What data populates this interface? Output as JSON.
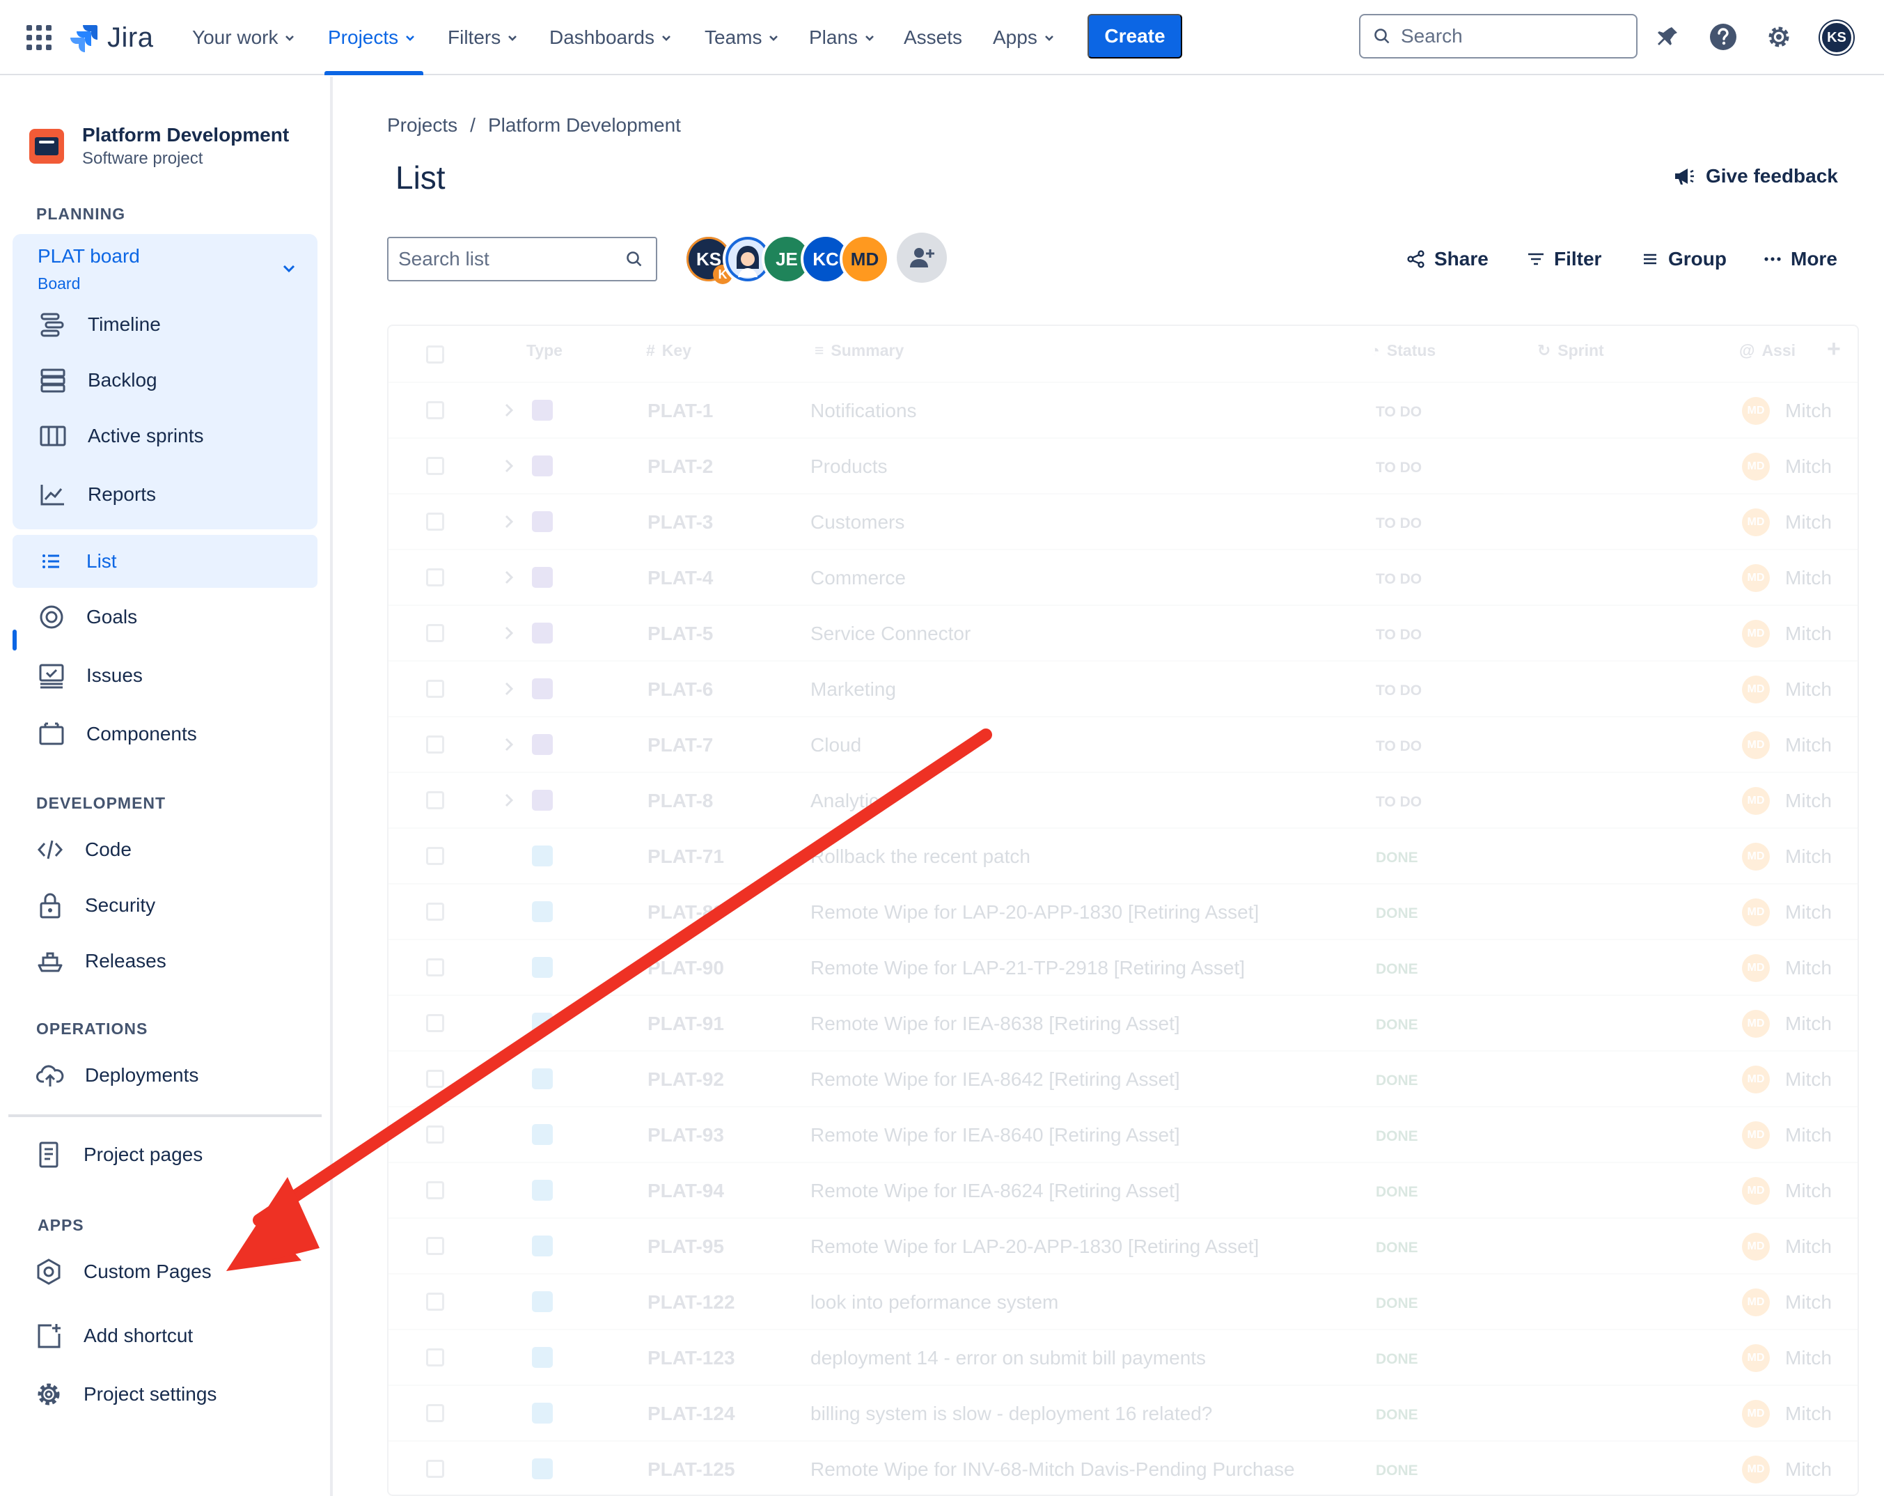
{
  "topnav": {
    "logo": "Jira",
    "items": [
      {
        "label": "Your work",
        "dropdown": true
      },
      {
        "label": "Projects",
        "dropdown": true,
        "active": true
      },
      {
        "label": "Filters",
        "dropdown": true
      },
      {
        "label": "Dashboards",
        "dropdown": true
      },
      {
        "label": "Teams",
        "dropdown": true
      },
      {
        "label": "Plans",
        "dropdown": true
      },
      {
        "label": "Assets",
        "dropdown": false
      },
      {
        "label": "Apps",
        "dropdown": true
      }
    ],
    "create_label": "Create",
    "search_placeholder": "Search",
    "user_initials": "KS"
  },
  "sidebar": {
    "project_name": "Platform Development",
    "project_type": "Software project",
    "planning_label": "PLANNING",
    "board_title": "PLAT board",
    "board_sub": "Board",
    "planning_items": [
      "Timeline",
      "Backlog",
      "Active sprints",
      "Reports"
    ],
    "main_items": [
      "List",
      "Goals",
      "Issues",
      "Components"
    ],
    "development_label": "DEVELOPMENT",
    "development_items": [
      "Code",
      "Security",
      "Releases"
    ],
    "operations_label": "OPERATIONS",
    "operations_items": [
      "Deployments"
    ],
    "project_pages": "Project pages",
    "apps_label": "APPS",
    "apps_items": [
      "Custom Pages"
    ],
    "add_shortcut": "Add shortcut",
    "project_settings": "Project settings"
  },
  "main": {
    "breadcrumb": [
      "Projects",
      "/",
      "Platform Development"
    ],
    "title": "List",
    "feedback": "Give feedback",
    "search_placeholder": "Search list",
    "avatars": [
      {
        "initials": "KS",
        "badge": "K",
        "color": "#172b4d"
      },
      {
        "initials": "",
        "color": "#1868db"
      },
      {
        "initials": "JE",
        "color": "#1f845a"
      },
      {
        "initials": "KC",
        "color": "#0055cc"
      },
      {
        "initials": "MD",
        "color": "#ff991f"
      }
    ],
    "share": "Share",
    "filter": "Filter",
    "group": "Group",
    "more": "More"
  },
  "table": {
    "headers": [
      "Type",
      "Key",
      "Summary",
      "Status",
      "Sprint",
      "Assi"
    ],
    "rows": [
      {
        "key": "PLAT-1",
        "summary": "Notifications",
        "status": "TO DO",
        "type": "epic"
      },
      {
        "key": "PLAT-2",
        "summary": "Products",
        "status": "TO DO",
        "type": "epic"
      },
      {
        "key": "PLAT-3",
        "summary": "Customers",
        "status": "TO DO",
        "type": "epic"
      },
      {
        "key": "PLAT-4",
        "summary": "Commerce",
        "status": "TO DO",
        "type": "epic"
      },
      {
        "key": "PLAT-5",
        "summary": "Service Connector",
        "status": "TO DO",
        "type": "epic"
      },
      {
        "key": "PLAT-6",
        "summary": "Marketing",
        "status": "TO DO",
        "type": "epic"
      },
      {
        "key": "PLAT-7",
        "summary": "Cloud",
        "status": "TO DO",
        "type": "epic"
      },
      {
        "key": "PLAT-8",
        "summary": "Analytics",
        "status": "TO DO",
        "type": "epic"
      },
      {
        "key": "PLAT-71",
        "summary": "Rollback the recent patch",
        "status": "DONE",
        "type": "task"
      },
      {
        "key": "PLAT-89",
        "summary": "Remote Wipe for LAP-20-APP-1830 [Retiring Asset]",
        "status": "DONE",
        "type": "task"
      },
      {
        "key": "PLAT-90",
        "summary": "Remote Wipe for LAP-21-TP-2918 [Retiring Asset]",
        "status": "DONE",
        "type": "task"
      },
      {
        "key": "PLAT-91",
        "summary": "Remote Wipe for IEA-8638 [Retiring Asset]",
        "status": "DONE",
        "type": "task"
      },
      {
        "key": "PLAT-92",
        "summary": "Remote Wipe for IEA-8642 [Retiring Asset]",
        "status": "DONE",
        "type": "task"
      },
      {
        "key": "PLAT-93",
        "summary": "Remote Wipe for IEA-8640 [Retiring Asset]",
        "status": "DONE",
        "type": "task"
      },
      {
        "key": "PLAT-94",
        "summary": "Remote Wipe for IEA-8624 [Retiring Asset]",
        "status": "DONE",
        "type": "task"
      },
      {
        "key": "PLAT-95",
        "summary": "Remote Wipe for LAP-20-APP-1830 [Retiring Asset]",
        "status": "DONE",
        "type": "task"
      },
      {
        "key": "PLAT-122",
        "summary": "look into peformance system",
        "status": "DONE",
        "type": "task"
      },
      {
        "key": "PLAT-123",
        "summary": "deployment 14 - error on submit bill payments",
        "status": "DONE",
        "type": "task"
      },
      {
        "key": "PLAT-124",
        "summary": "billing system is slow - deployment 16 related?",
        "status": "DONE",
        "type": "task"
      },
      {
        "key": "PLAT-125",
        "summary": "Remote Wipe for INV-68-Mitch Davis-Pending Purchase",
        "status": "DONE",
        "type": "task"
      }
    ],
    "assignee_initials": "MD",
    "assignee_name": "Mitch"
  },
  "colors": {
    "accent": "#0c66e4",
    "annotation": "#ee3124"
  }
}
